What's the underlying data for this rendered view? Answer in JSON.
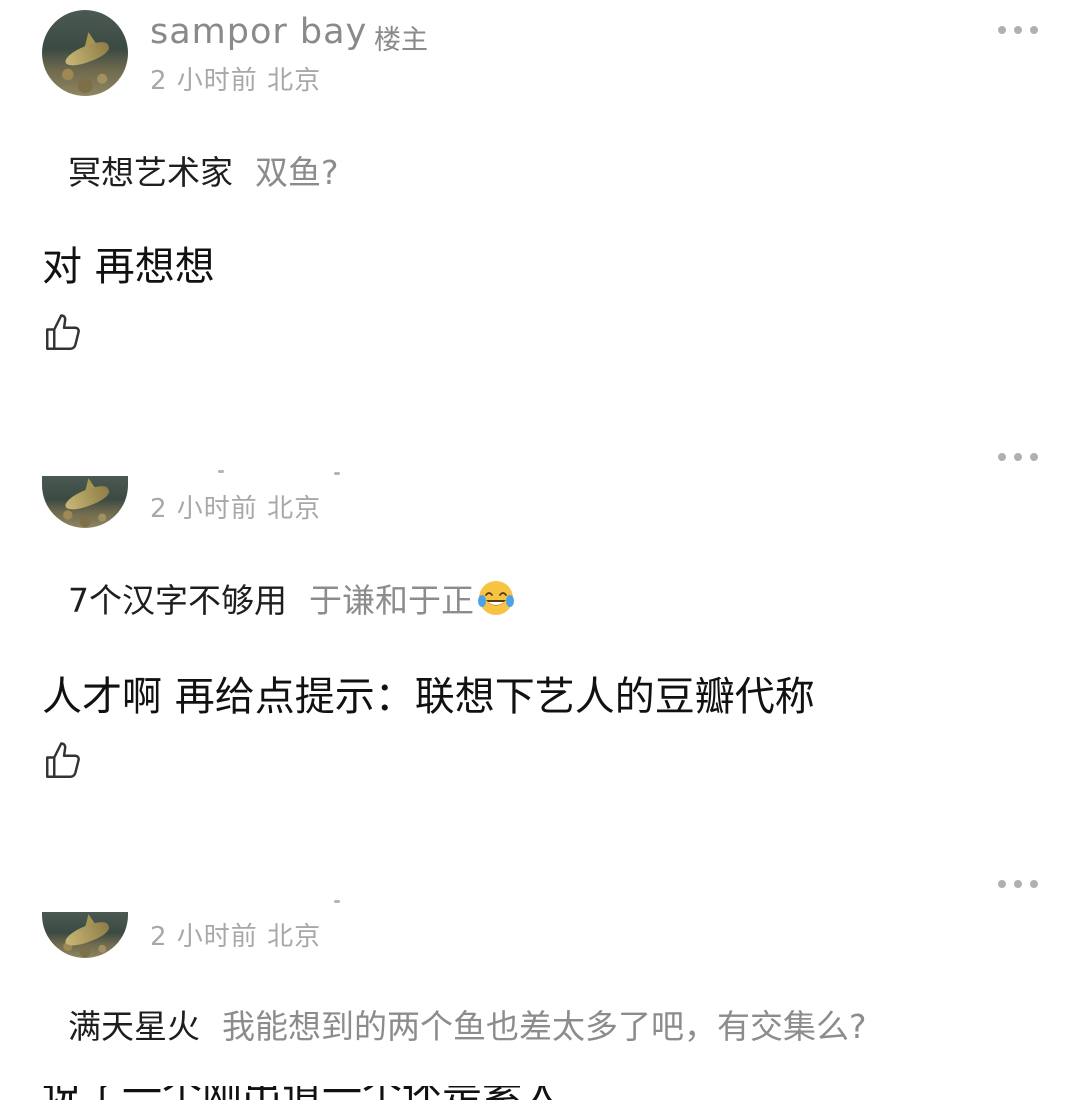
{
  "comments": [
    {
      "username": "sampor bay",
      "badge": "楼主",
      "meta": "2 小时前 北京",
      "quote_author": "冥想艺术家",
      "quote_text": "双鱼?",
      "reply": "对 再想想"
    },
    {
      "username": "",
      "meta": "2 小时前 北京",
      "quote_author": "7个汉字不够用",
      "quote_text": "于谦和于正",
      "emoji": "face-with-tears-of-joy-emoji",
      "reply": "人才啊  再给点提示：联想下艺人的豆瓣代称"
    },
    {
      "username": "",
      "meta": "2 小时前 北京",
      "quote_author": "满天星火",
      "quote_text": "我能想到的两个鱼也差太多了吧，有交集么?",
      "reply_partial": "说了一个刚出道一个还是素人"
    }
  ],
  "icons": {
    "more": "more-horizontal-icon",
    "like": "thumbs-up-icon"
  },
  "colors": {
    "meta_gray": "#a8a8a8",
    "username_gray": "#8a8a8a",
    "quote_gray": "#8c8c8c",
    "emoji_yellow": "#f6c342"
  }
}
